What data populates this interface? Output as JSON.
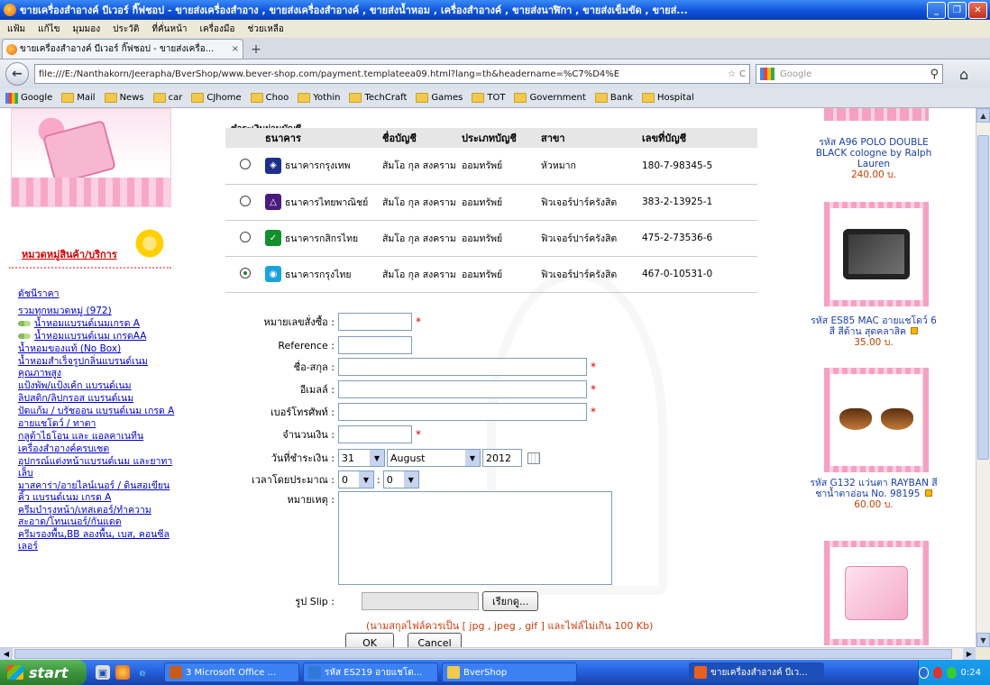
{
  "window": {
    "title": "ขายเครื่องสำอางค์ บีเวอร์ กิ๊ฟชอป - ขายส่งเครื่องสำอาง , ขายส่งเครื่องสำอางค์ , ขายส่งน้ำหอม , เครื่องสำอางค์ , ขายส่งนาฬิกา , ขายส่งเข็มขัด , ขายส่...",
    "min": "_",
    "max": "❐",
    "close": "✕"
  },
  "menu": [
    "แฟ้ม",
    "แก้ไข",
    "มุมมอง",
    "ประวัติ",
    "ที่คั่นหน้า",
    "เครื่องมือ",
    "ช่วยเหลือ"
  ],
  "tab": {
    "label": "ขายเครื่องสำอางค์ บีเวอร์ กิ๊ฟชอป - ขายส่งเครื่อ...",
    "close": "×",
    "new": "+"
  },
  "nav": {
    "back": "←",
    "url": "file:///E:/Nanthakorn/Jeerapha/BverShop/www.bever-shop.com/payment.templateea09.html?lang=th&headername=%C7%D4%E",
    "search_placeholder": "Google",
    "star": "☆",
    "reload": "C"
  },
  "bookmarks": [
    "Google",
    "Mail",
    "News",
    "car",
    "CJhome",
    "Choo",
    "Yothin",
    "TechCraft",
    "Games",
    "TOT",
    "Government",
    "Bank",
    "Hospital"
  ],
  "sidebar": {
    "category_title": "หมวดหมู่สินค้า/บริการ",
    "links": [
      {
        "text": "ดัชนีราคา",
        "sub": false
      },
      {
        "text": "รวมทุกหมวดหมู่ (972)",
        "sub": false
      },
      {
        "text": "น้ำหอมแบรนด์เนมเกรด A",
        "sub": true
      },
      {
        "text": "น้ำหอมแบรนด์เนม เกรดAA",
        "sub": true
      },
      {
        "text": "น้ำหอมของแท้ (No Box)",
        "sub": false
      },
      {
        "text": "น้ำหอมสำเร็จรูปกลิ่นแบรนด์เนมคุณภาพสูง",
        "sub": false
      },
      {
        "text": "แป้งพัพ/แป้งเค้ก แบรนด์เนม",
        "sub": false
      },
      {
        "text": "ลิปสติก/ลิปกรอส แบรนด์เนม",
        "sub": false
      },
      {
        "text": "ปัดแก้ม / บรัชออน แบรนด์เนม เกรด A",
        "sub": false
      },
      {
        "text": "อายแชโดว์ / ทาตา",
        "sub": false
      },
      {
        "text": "กลูต้าไธโอน และ แอลคาเนทีน",
        "sub": false
      },
      {
        "text": "เครื่องสำอางค์ครบเซต",
        "sub": false
      },
      {
        "text": "อุปกรณ์แต่งหน้าแบรนด์เนม และยาทาเล็บ",
        "sub": false
      },
      {
        "text": "มาสคาร่า/อายไลน์เนอร์ / ดินสอเขียนคิ้ว แบรนด์เนม เกรด A",
        "sub": false
      },
      {
        "text": "ครีมบำรุงหน้า/เทสเตอร์/ทำความสะอาด/โทนเนอร์/กันแดด",
        "sub": false
      },
      {
        "text": "ครีมรองพื้น,BB ลองพื้น, เบส, คอนซีลเลอร์",
        "sub": false
      }
    ]
  },
  "bank": {
    "section_title": "ชำระเงินผ่านบัญชี",
    "headers": [
      "ธนาคาร",
      "ชื่อบัญชี",
      "ประเภทบัญชี",
      "สาขา",
      "เลขที่บัญชี"
    ],
    "rows": [
      {
        "bank": "ธนาคารกรุงเทพ",
        "name": "สัมโอ กุล สงคราม",
        "type": "ออมทรัพย์",
        "branch": "หัวหมาก",
        "number": "180-7-98345-5",
        "logo_color": "#1e2f8c",
        "logo_glyph": "◈",
        "checked": false
      },
      {
        "bank": "ธนาคารไทยพาณิชย์",
        "name": "สัมโอ กุล สงคราม",
        "type": "ออมทรัพย์",
        "branch": "ฟิวเจอร์ปาร์ครังสิต",
        "number": "383-2-13925-1",
        "logo_color": "#4b1b7f",
        "logo_glyph": "△",
        "checked": false
      },
      {
        "bank": "ธนาคารกสิกรไทย",
        "name": "สัมโอ กุล สงคราม",
        "type": "ออมทรัพย์",
        "branch": "ฟิวเจอร์ปาร์ครังสิต",
        "number": "475-2-73536-6",
        "logo_color": "#138f2d",
        "logo_glyph": "✓",
        "checked": false
      },
      {
        "bank": "ธนาคารกรุงไทย",
        "name": "สัมโอ กุล สงคราม",
        "type": "ออมทรัพย์",
        "branch": "ฟิวเจอร์ปาร์ครังสิต",
        "number": "467-0-10531-0",
        "logo_color": "#1aa3d9",
        "logo_glyph": "◉",
        "checked": true
      }
    ]
  },
  "form": {
    "order_no": "หมายเลขสั่งซื้อ :",
    "reference": "Reference :",
    "fullname": "ชื่อ-สกุล :",
    "email": "อีเมลล์ :",
    "phone": "เบอร์โทรศัพท์ :",
    "amount": "จำนวนเงิน :",
    "pay_date": "วันที่ชำระเงิน :",
    "day": "31",
    "month": "August",
    "year": "2012",
    "approx_time": "เวลาโดยประมาณ :",
    "hour": "0",
    "minute": "0",
    "time_sep": ":",
    "remark": "หมายเหตุ :",
    "slip": "รูป Slip :",
    "browse": "เรียกดู...",
    "note": "(นามสกุลไฟล์ควรเป็น [ jpg , jpeg , gif ] และไฟล์ไม่เกิน 100 Kb)",
    "ok": "OK",
    "cancel": "Cancel",
    "required": "*"
  },
  "products": [
    {
      "caption": "รหัส A96 POLO DOUBLE BLACK cologne by Ralph Lauren",
      "price": "240.00 บ.",
      "sale": false
    },
    {
      "caption": "รหัส ES85 MAC อายแชโดว์ 6 สี สีด้าน สุดคลาสิค",
      "price": "35.00 บ.",
      "sale": true
    },
    {
      "caption": "รหัส G132 แว่นตา RAYBAN สีชาน้ำตาอ่อน No. 98195",
      "price": "60.00 บ.",
      "sale": true
    }
  ],
  "taskbar": {
    "start": "start",
    "items": [
      {
        "label": "3 Microsoft Office ...",
        "color": "#c75b1c"
      },
      {
        "label": "รหัส ES219 อายแชโด...",
        "color": "#2f7ad8"
      },
      {
        "label": "BverShop",
        "color": "#f2c94c"
      },
      {
        "label": "ขายเครื่องสำอางค์ บีเว...",
        "color": "#e8601c"
      }
    ],
    "clock": "0:24"
  }
}
